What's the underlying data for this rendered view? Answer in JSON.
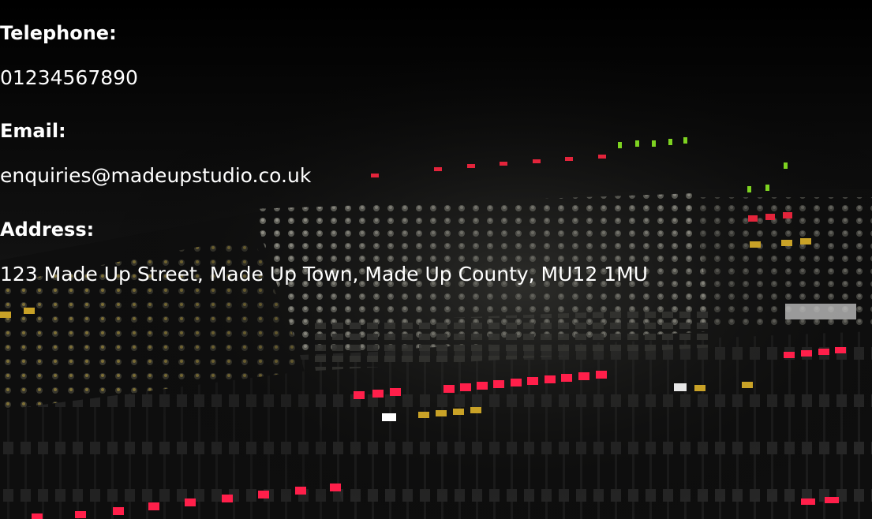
{
  "contact": {
    "telephone_label": "Telephone:",
    "telephone_value": "01234567890",
    "email_label": "Email:",
    "email_value": "enquiries@madeupstudio.co.uk",
    "address_label": "Address:",
    "address_value": "123 Made Up Street, Made Up Town, Made Up County, MU12 1MU"
  },
  "background": {
    "image_subject": "audio-mixing-console-photo"
  }
}
